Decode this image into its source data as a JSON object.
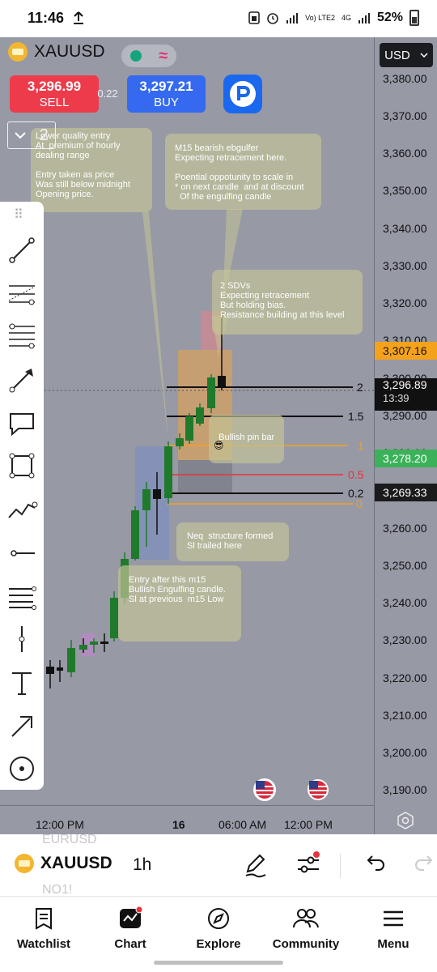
{
  "status_bar": {
    "time": "11:46",
    "network": "Vo) LTE2",
    "signal": "4G",
    "battery": "52%"
  },
  "chart": {
    "symbol": "XAUUSD",
    "sell": {
      "price": "3,296.99",
      "label": "SELL"
    },
    "buy": {
      "price": "3,297.21",
      "label": "BUY"
    },
    "spread": "0.22",
    "collapse_count": "2",
    "currency": "USD",
    "price_axis": [
      "3,380.00",
      "3,370.00",
      "3,360.00",
      "3,350.00",
      "3,340.00",
      "3,330.00",
      "3,320.00",
      "3,310.00",
      "3,300.00",
      "3,290.00",
      "3,280.00",
      "3,260.00",
      "3,250.00",
      "3,240.00",
      "3,230.00",
      "3,220.00",
      "3,210.00",
      "3,200.00",
      "3,190.00"
    ],
    "price_tags": {
      "resistance": "3,307.16",
      "current": "3,296.89",
      "countdown": "13:39",
      "green_level": "3,278.20",
      "black_level": "3,269.33"
    },
    "fib_levels": [
      "2",
      "1.5",
      "1",
      "0.5",
      "0.2",
      "0"
    ],
    "time_axis": [
      "12:00 PM",
      "16",
      "06:00 AM",
      "12:00 PM"
    ],
    "notes": [
      "Lower quality entry\nAt  premium of hourly\ndealing range\n\nEntry taken as price\nWas still below midnight\nOpening price.",
      "M15 bearish ebgulfer\nExpecting retracement here.\n\nPoential oppotunity to scale in\n* on next candle  and at discount\n  Of the engulfing candle",
      "2 SDVs\nExpecting retracement\nBut holding bias.\nResistance building at this level",
      "Bullish pin bar",
      "Neq  structure formed\nSl trailed here",
      "Entry after this m15\nBullish Engulfing candle.\nSl at previous  m15 Low"
    ],
    "emoji": "😎",
    "colors": {
      "chart_bg": "#9799a5",
      "bull_candle": "#1f7a2c",
      "bear_candle": "#111111",
      "sell": "#ee3b4b",
      "buy": "#3469f0",
      "resistance_tag": "#f4a21c",
      "green_tag": "#3bb25a",
      "fib_orange": "#f4a21c",
      "fib_red": "#e8333c"
    }
  },
  "bottom_toolbar": {
    "symbol": "XAUUSD",
    "ghost_top": "EURUSD",
    "ghost_bottom": "NO1!",
    "interval": "1h"
  },
  "nav": [
    {
      "label": "Watchlist",
      "icon": "watchlist-icon"
    },
    {
      "label": "Chart",
      "icon": "chart-icon"
    },
    {
      "label": "Explore",
      "icon": "compass-icon"
    },
    {
      "label": "Community",
      "icon": "community-icon"
    },
    {
      "label": "Menu",
      "icon": "menu-icon"
    }
  ]
}
